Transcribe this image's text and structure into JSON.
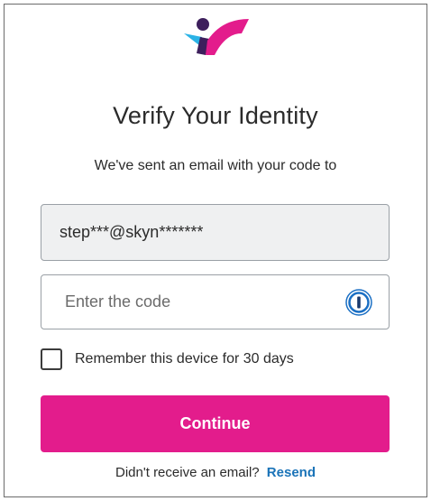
{
  "logo": {
    "icon": "brand-logo-icon",
    "colors": [
      "#e31c8c",
      "#2bb3e6",
      "#3d1f5c"
    ]
  },
  "title": "Verify Your Identity",
  "subtitle": "We've sent an email with your code to",
  "email": {
    "value": "step***@skyn*******"
  },
  "code_input": {
    "placeholder": "Enter the code",
    "value": "",
    "icon": "password-manager-icon"
  },
  "remember": {
    "label": "Remember this device for 30 days",
    "checked": false
  },
  "continue_button": {
    "label": "Continue",
    "color": "#e31c8c"
  },
  "footer": {
    "prompt": "Didn't receive an email?",
    "resend_label": "Resend"
  }
}
